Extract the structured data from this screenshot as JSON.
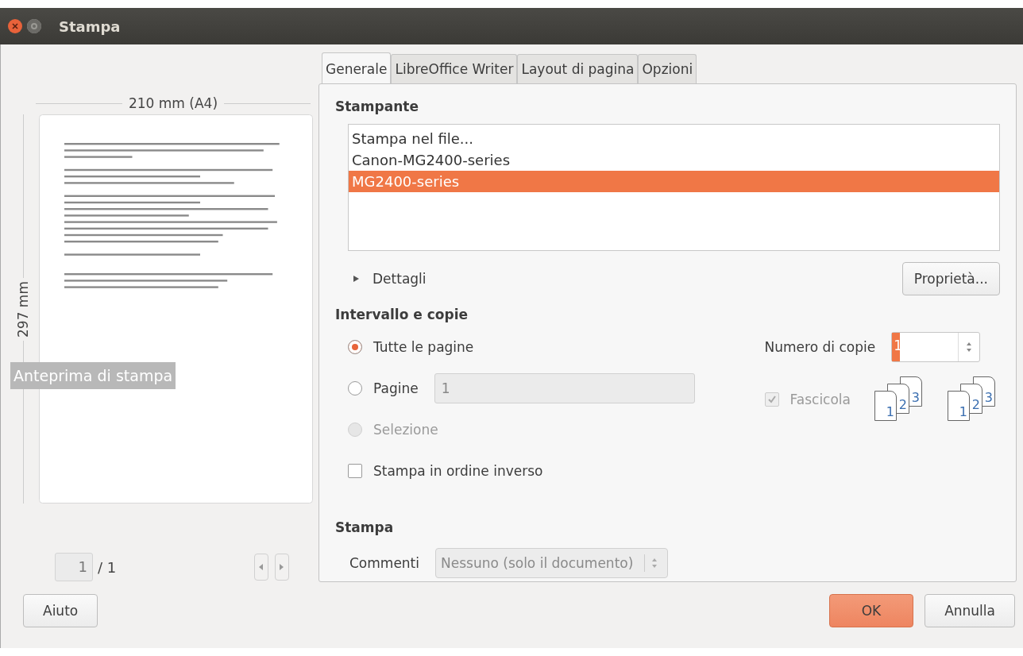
{
  "window": {
    "title": "Stampa"
  },
  "preview": {
    "width_label": "210 mm (A4)",
    "height_label": "297 mm",
    "tooltip": "Anteprima di stampa",
    "page_field": "1",
    "page_total": "/ 1"
  },
  "tabs": [
    {
      "label": "Generale",
      "selected": true
    },
    {
      "label": "LibreOffice Writer",
      "selected": false
    },
    {
      "label": "Layout di pagina",
      "selected": false
    },
    {
      "label": "Opzioni",
      "selected": false
    }
  ],
  "printer": {
    "heading": "Stampante",
    "items": [
      {
        "name": "Stampa nel file...",
        "selected": false
      },
      {
        "name": "Canon-MG2400-series",
        "selected": false
      },
      {
        "name": "MG2400-series",
        "selected": true
      }
    ],
    "details": {
      "label": "Dettagli",
      "expanded": false
    },
    "properties_button": "Proprietà..."
  },
  "range": {
    "heading": "Intervallo e copie",
    "options": [
      {
        "label": "Tutte le pagine",
        "selected": true,
        "disabled": false
      },
      {
        "label": "Pagine",
        "selected": false,
        "disabled": false,
        "value": "1"
      },
      {
        "label": "Selezione",
        "selected": false,
        "disabled": true
      }
    ],
    "reverse": {
      "label": "Stampa in ordine inverso",
      "checked": false
    },
    "copies_label": "Numero di copie",
    "copies": "1",
    "collate": {
      "label": "Fascicola",
      "checked": true,
      "disabled": true
    },
    "collate_icons": [
      [
        "1",
        "2",
        "3"
      ],
      [
        "1",
        "2",
        "3"
      ]
    ]
  },
  "print": {
    "heading": "Stampa",
    "comments_label": "Commenti",
    "comments_value": "Nessuno (solo il documento)"
  },
  "buttons": {
    "help": "Aiuto",
    "ok": "OK",
    "cancel": "Annulla"
  }
}
